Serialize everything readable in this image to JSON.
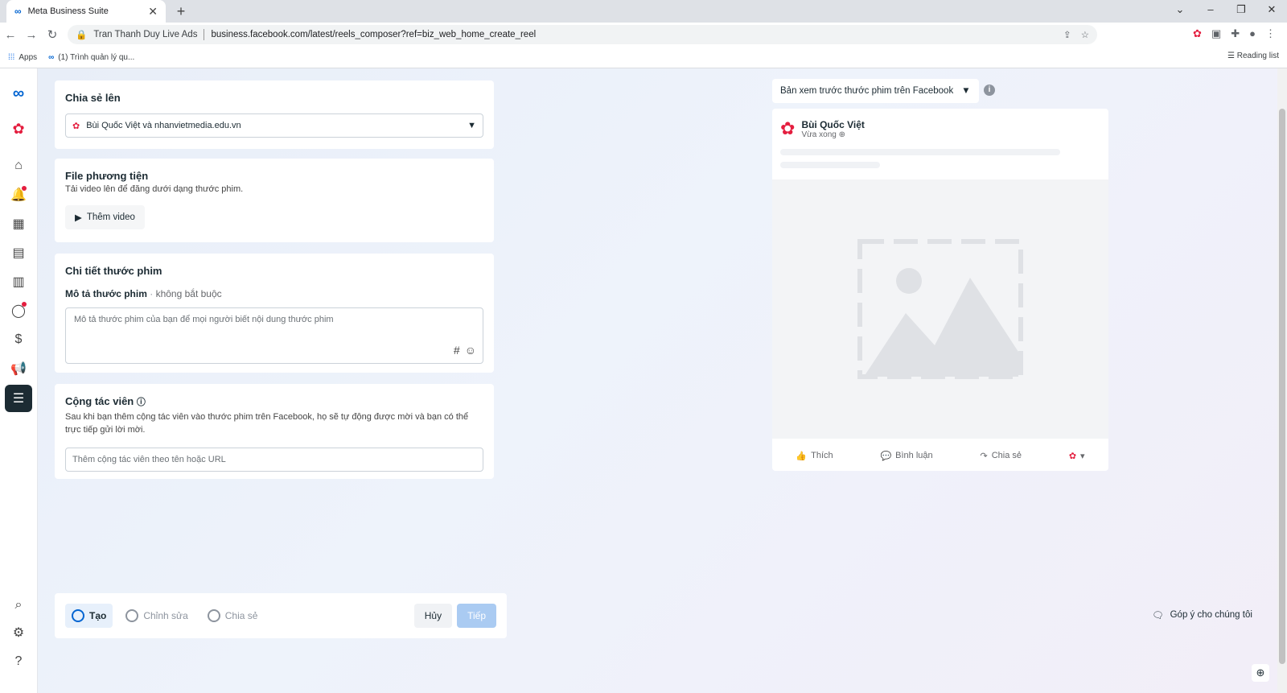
{
  "browser": {
    "tab_title": "Meta Business Suite",
    "site_name": "Tran Thanh Duy Live Ads",
    "url": "business.facebook.com/latest/reels_composer?ref=biz_web_home_create_reel",
    "bookmarks": [
      "Apps",
      "(1) Trình quản lý qu..."
    ],
    "reading_list": "Reading list"
  },
  "share": {
    "title": "Chia sẻ lên",
    "selected": "Bùi Quốc Việt và nhanvietmedia.edu.vn"
  },
  "media": {
    "title": "File phương tiện",
    "subtitle": "Tải video lên để đăng dưới dạng thước phim.",
    "add_button": "Thêm video"
  },
  "details": {
    "title": "Chi tiết thước phim",
    "desc_label": "Mô tả thước phim",
    "desc_optional": "không bắt buộc",
    "desc_placeholder": "Mô tả thước phim của bạn để mọi người biết nội dung thước phim",
    "hash": "#"
  },
  "collab": {
    "title": "Cộng tác viên",
    "desc": "Sau khi bạn thêm cộng tác viên vào thước phim trên Facebook, họ sẽ tự động được mời và bạn có thể trực tiếp gửi lời mời.",
    "placeholder": "Thêm cộng tác viên theo tên hoặc URL"
  },
  "steps": {
    "items": [
      "Tạo",
      "Chỉnh sửa",
      "Chia sẻ"
    ],
    "cancel": "Hủy",
    "next": "Tiếp"
  },
  "preview": {
    "selector": "Bản xem trước thước phim trên Facebook",
    "page_name": "Bùi Quốc Việt",
    "time": "Vừa xong",
    "like": "Thích",
    "comment": "Bình luận",
    "share": "Chia sẻ"
  },
  "feedback": "Góp ý cho chúng tôi",
  "colors": {
    "brand": "#0064d1",
    "notify": "#e41e3f",
    "active_rail": "#1c2b33"
  }
}
